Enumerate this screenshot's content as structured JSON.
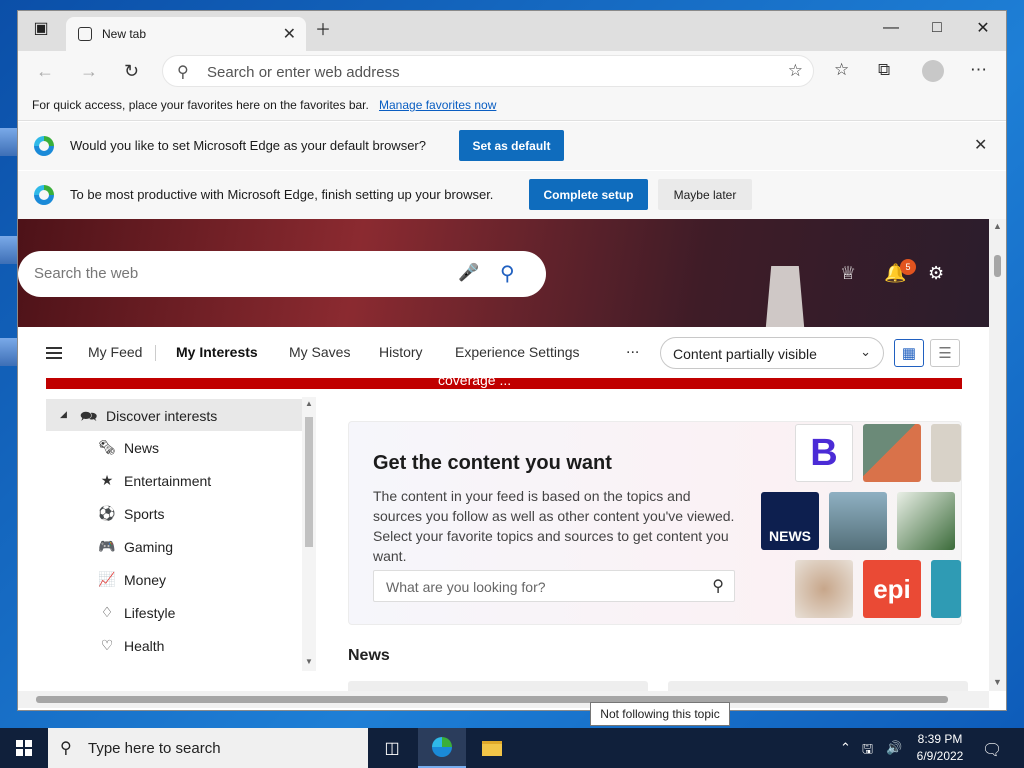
{
  "browser": {
    "tab_title": "New tab",
    "address_placeholder": "Search or enter web address"
  },
  "favbar": {
    "text": "For quick access, place your favorites here on the favorites bar.",
    "link": "Manage favorites now"
  },
  "infobar_default": {
    "text": "Would you like to set Microsoft Edge as your default browser?",
    "button": "Set as default"
  },
  "infobar_setup": {
    "text": "To be most productive with Microsoft Edge, finish setting up your browser.",
    "primary_button": "Complete setup",
    "secondary_button": "Maybe later"
  },
  "hero": {
    "search_placeholder": "Search the web",
    "notification_count": "5"
  },
  "feed_nav": {
    "tabs": [
      "My Feed",
      "My Interests",
      "My Saves",
      "History",
      "Experience Settings"
    ],
    "active_tab": "My Interests",
    "more": "...",
    "visibility_select": "Content partially visible"
  },
  "banner": {
    "text": "coverage ..."
  },
  "interests": {
    "header": "Discover interests",
    "items": [
      "News",
      "Entertainment",
      "Sports",
      "Gaming",
      "Money",
      "Lifestyle",
      "Health"
    ]
  },
  "card": {
    "title": "Get the content you want",
    "body": "The content in your feed is based on the topics and sources you follow as well as other content you've viewed. Select your favorite topics and sources to get content you want.",
    "search_placeholder": "What are you looking for?",
    "tiles": [
      "B",
      "NEWS",
      "epi"
    ]
  },
  "news": {
    "heading": "News"
  },
  "tooltip": "Not following this topic",
  "taskbar": {
    "search_placeholder": "Type here to search",
    "time": "8:39 PM",
    "date": "6/9/2022"
  },
  "colors": {
    "accent": "#0f6cbd",
    "banner_red": "#c00000",
    "taskbar": "#10203b"
  }
}
